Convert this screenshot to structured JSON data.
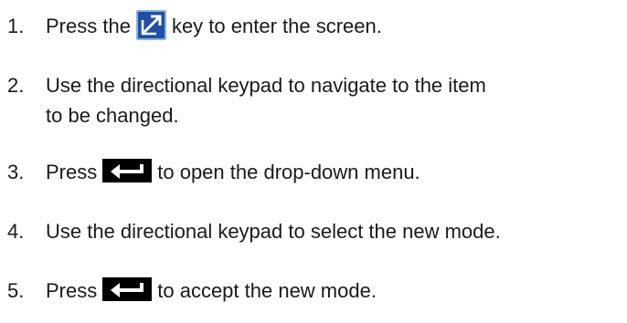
{
  "steps": [
    {
      "number": "1.",
      "before": "Press the",
      "icon": "edit-key-icon",
      "after": "key to enter the screen."
    },
    {
      "number": "2.",
      "line1": "Use the directional keypad to navigate to the item",
      "line2": "to be changed."
    },
    {
      "number": "3.",
      "before": "Press",
      "icon": "enter-key-icon",
      "after": "to open the drop-down menu."
    },
    {
      "number": "4.",
      "text": "Use the directional keypad to select the new mode."
    },
    {
      "number": "5.",
      "before": "Press",
      "icon": "enter-key-icon",
      "after": "to accept the new mode."
    }
  ],
  "colors": {
    "edit_key_background": "#1f4fa8",
    "enter_key_background": "#000000",
    "text": "#1a1a1a"
  }
}
